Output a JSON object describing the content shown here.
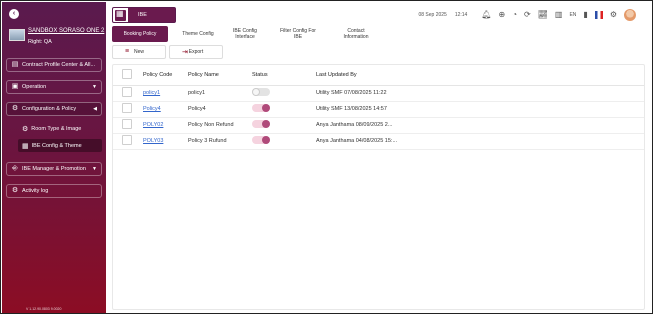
{
  "sidebar": {
    "hotel_name": "SANDBOX SORASO ONE 2",
    "right_label": "Right: QA",
    "items": [
      {
        "label": "Contract Profile Center & All...",
        "icon": "document-icon"
      },
      {
        "label": "Operation",
        "icon": "operation-icon"
      },
      {
        "label": "Configuration & Policy",
        "icon": "gear-icon"
      },
      {
        "label": "Room Type & Image",
        "icon": "room-icon"
      },
      {
        "label": "IBE Config & Theme",
        "icon": "theme-icon"
      },
      {
        "label": "IBE Manager & Promotion",
        "icon": "promotion-icon"
      },
      {
        "label": "Activity log",
        "icon": "activity-icon"
      }
    ],
    "version": "V 1.12.90.0803 9.0020"
  },
  "module": {
    "label": "IBE"
  },
  "topbar": {
    "date": "08 Sep 2025",
    "time": "12:14",
    "language": "EN"
  },
  "tabs": [
    {
      "label": "Booking Policy"
    },
    {
      "label": "Theme Config"
    },
    {
      "label": "IBE Config Interface"
    },
    {
      "label": "Filter Config For IBE"
    },
    {
      "label": "Contact Information"
    }
  ],
  "actions": {
    "new_label": "New",
    "export_label": "Export"
  },
  "table": {
    "columns": [
      "Policy Code",
      "Policy Name",
      "Status",
      "Last Updated By"
    ],
    "rows": [
      {
        "code": "policy1",
        "name": "policy1",
        "status": "off",
        "updated": "Utility SMF 07/08/2025 11:22"
      },
      {
        "code": "Policy4",
        "name": "Policy4",
        "status": "on",
        "updated": "Utility SMF 13/08/2025 14:57"
      },
      {
        "code": "POLY02",
        "name": "Policy Non Refund",
        "status": "on",
        "updated": "Anya Janthama 08/09/2025 2..."
      },
      {
        "code": "POLY03",
        "name": "Policy 3 Rufund",
        "status": "on",
        "updated": "Anya Janthama 04/08/2025 15:..."
      }
    ]
  },
  "colors": {
    "brand": "#6a1a4e",
    "accent": "#8c0d24",
    "link": "#3366cc"
  }
}
